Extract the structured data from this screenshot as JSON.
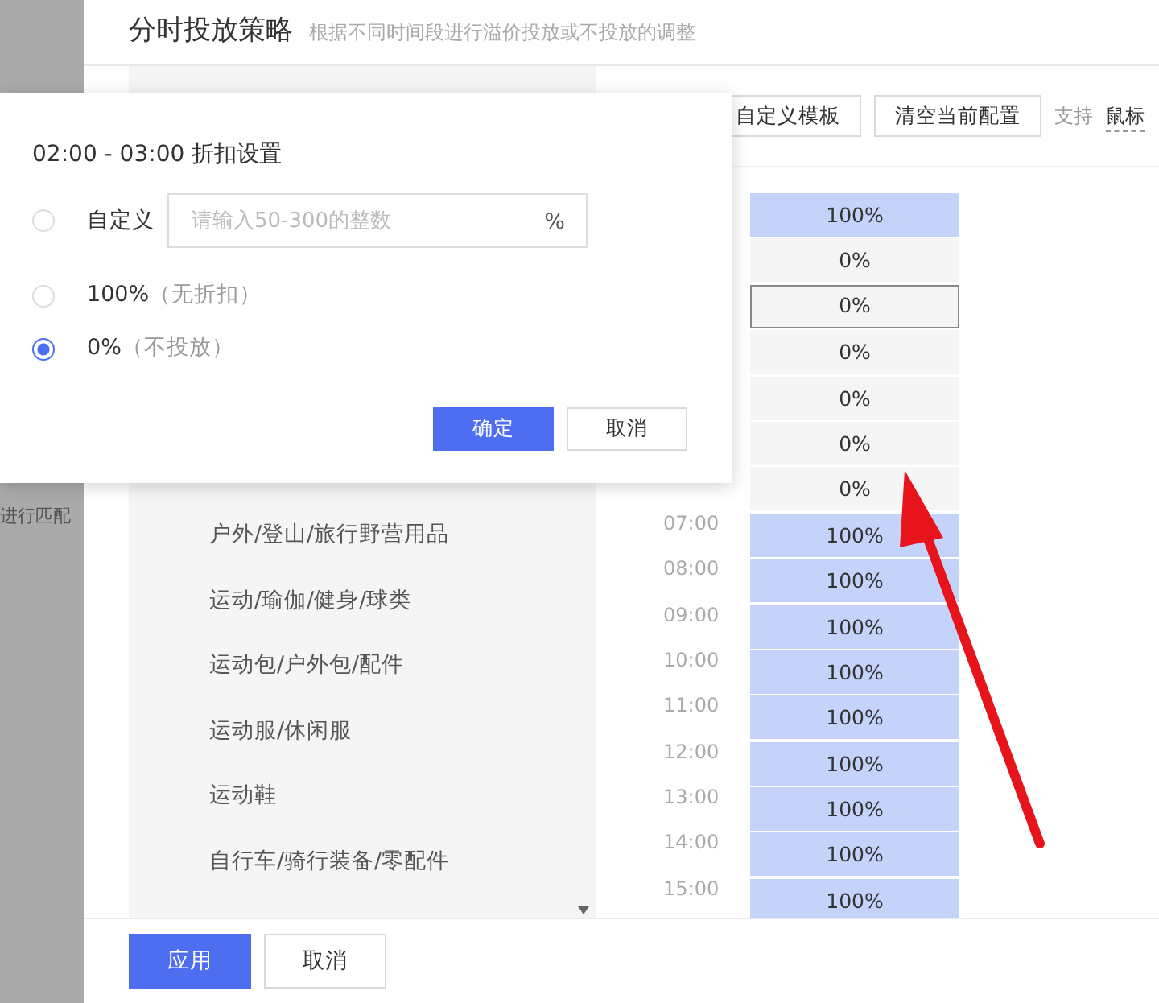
{
  "page": {
    "title": "分时投放策略",
    "subtitle": "根据不同时间段进行溢价投放或不投放的调整",
    "side_text": "进行匹配"
  },
  "toolbar": {
    "buttons": [
      "自定义模板",
      "清空当前配置"
    ],
    "hint": "支持",
    "hint_link": "鼠标"
  },
  "categories": [
    "户外/登山/旅行野营用品",
    "运动/瑜伽/健身/球类",
    "运动包/户外包/配件",
    "运动服/休闲服",
    "运动鞋",
    "自行车/骑行装备/零配件"
  ],
  "schedule": [
    {
      "value": "100%",
      "on": true,
      "selected": false
    },
    {
      "value": "0%",
      "on": false,
      "selected": false
    },
    {
      "value": "0%",
      "on": false,
      "selected": true
    },
    {
      "value": "0%",
      "on": false,
      "selected": false
    },
    {
      "value": "0%",
      "on": false,
      "selected": false
    },
    {
      "value": "0%",
      "on": false,
      "selected": false
    },
    {
      "value": "0%",
      "on": false,
      "selected": false
    },
    {
      "time": "07:00",
      "value": "100%",
      "on": true,
      "selected": false
    },
    {
      "time": "08:00",
      "value": "100%",
      "on": true,
      "selected": false
    },
    {
      "time": "09:00",
      "value": "100%",
      "on": true,
      "selected": false
    },
    {
      "time": "10:00",
      "value": "100%",
      "on": true,
      "selected": false
    },
    {
      "time": "11:00",
      "value": "100%",
      "on": true,
      "selected": false
    },
    {
      "time": "12:00",
      "value": "100%",
      "on": true,
      "selected": false
    },
    {
      "time": "13:00",
      "value": "100%",
      "on": true,
      "selected": false
    },
    {
      "time": "14:00",
      "value": "100%",
      "on": true,
      "selected": false
    },
    {
      "time": "15:00",
      "value": "100%",
      "on": true,
      "selected": false
    }
  ],
  "popover": {
    "title": "02:00 - 03:00 折扣设置",
    "options": [
      {
        "kind": "custom",
        "label": "自定义",
        "placeholder": "请输入50-300的整数",
        "unit": "%",
        "selected": false
      },
      {
        "kind": "plain",
        "label": "100%",
        "note": "（无折扣）",
        "selected": false
      },
      {
        "kind": "plain",
        "label": "0%",
        "note": "（不投放）",
        "selected": true
      }
    ],
    "buttons": [
      {
        "label": "确定",
        "primary": true
      },
      {
        "label": "取消",
        "primary": false
      }
    ]
  },
  "footer": {
    "buttons": [
      {
        "label": "应用",
        "primary": true
      },
      {
        "label": "取消",
        "primary": false
      }
    ]
  }
}
